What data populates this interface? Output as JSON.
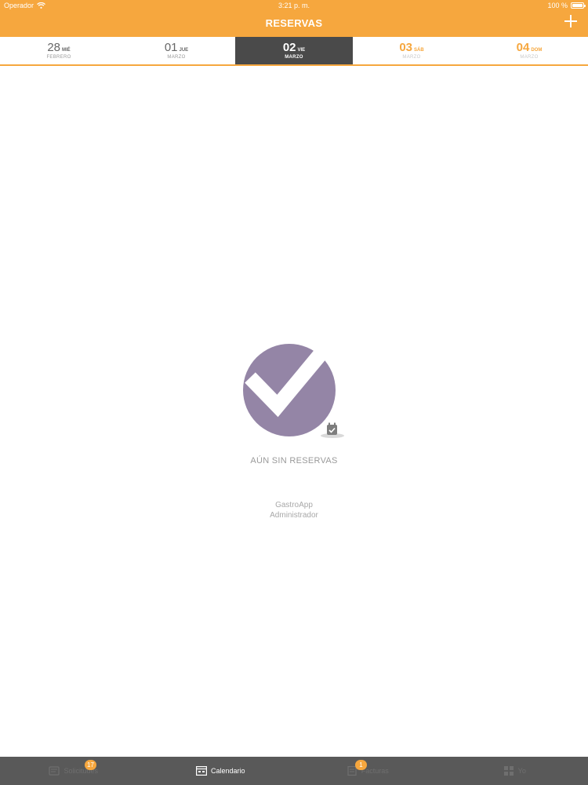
{
  "status_bar": {
    "carrier": "Operador",
    "time": "3:21 p. m.",
    "battery": "100 %",
    "battery_level": 1.0
  },
  "nav": {
    "title": "RESERVAS",
    "add_icon": "plus-icon"
  },
  "date_strip": [
    {
      "day": "28",
      "weekday": "MIÉ",
      "month": "FEBRERO",
      "state": "past"
    },
    {
      "day": "01",
      "weekday": "JUE",
      "month": "MARZO",
      "state": "past"
    },
    {
      "day": "02",
      "weekday": "VIE",
      "month": "MARZO",
      "state": "selected"
    },
    {
      "day": "03",
      "weekday": "SÁB",
      "month": "MARZO",
      "state": "future"
    },
    {
      "day": "04",
      "weekday": "DOM",
      "month": "MARZO",
      "state": "future"
    }
  ],
  "empty_state": {
    "icon": "check-circle-icon",
    "title": "AÚN SIN RESERVAS",
    "app_name": "GastroApp",
    "app_role": "Administrador"
  },
  "tab_bar": [
    {
      "label": "Solicitudes",
      "badge": "17",
      "icon": "requests-icon",
      "active": false
    },
    {
      "label": "Calendario",
      "badge": "",
      "icon": "calendar-icon",
      "active": true
    },
    {
      "label": "Facturas",
      "badge": "1",
      "icon": "invoices-icon",
      "active": false
    },
    {
      "label": "Yo",
      "badge": "",
      "icon": "grid-icon",
      "active": false
    }
  ],
  "colors": {
    "accent": "#f6a73e",
    "selected_date_bg": "#4a4a4a",
    "tab_bar_bg": "#595959",
    "empty_icon": "#9485a6"
  }
}
